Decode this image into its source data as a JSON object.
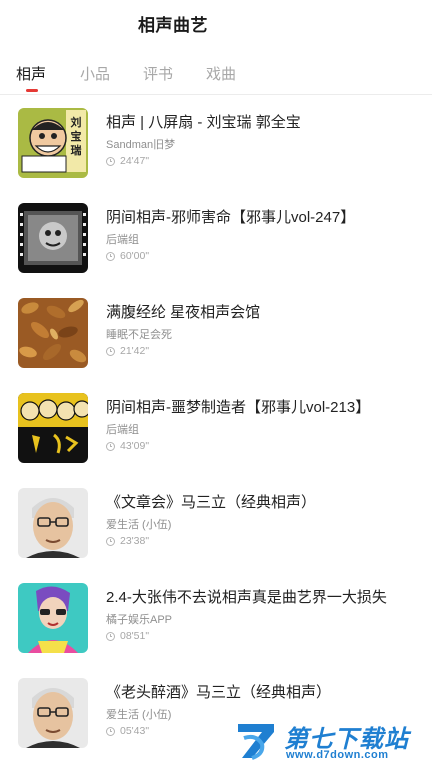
{
  "header": {
    "title": "相声曲艺"
  },
  "tabs": [
    {
      "label": "相声",
      "active": true
    },
    {
      "label": "小品",
      "active": false
    },
    {
      "label": "评书",
      "active": false
    },
    {
      "label": "戏曲",
      "active": false
    }
  ],
  "items": [
    {
      "title": "相声 | 八屏扇 - 刘宝瑞 郭全宝",
      "author": "Sandman旧梦",
      "duration": "24'47\"",
      "thumb_text": "刘宝瑞"
    },
    {
      "title": "阴间相声-邪师害命【邪事儿vol-247】",
      "author": "后端组",
      "duration": "60'00\""
    },
    {
      "title": "满腹经纶 星夜相声会馆",
      "author": "睡眠不足会死",
      "duration": "21'42\""
    },
    {
      "title": "阴间相声-噩梦制造者【邪事儿vol-213】",
      "author": "后端组",
      "duration": "43'09\""
    },
    {
      "title": "《文章会》马三立（经典相声）",
      "author": "爱生活 (小伍)",
      "duration": "23'38\""
    },
    {
      "title": "2.4-大张伟不去说相声真是曲艺界一大损失",
      "author": "橘子娱乐APP",
      "duration": "08'51\""
    },
    {
      "title": "《老头醉酒》马三立（经典相声）",
      "author": "爱生活 (小伍)",
      "duration": "05'43\""
    }
  ],
  "watermark": {
    "name": "第七下载站",
    "url": "www.d7down.com"
  },
  "colors": {
    "accent": "#e53935",
    "watermark": "#1f7fd1"
  }
}
